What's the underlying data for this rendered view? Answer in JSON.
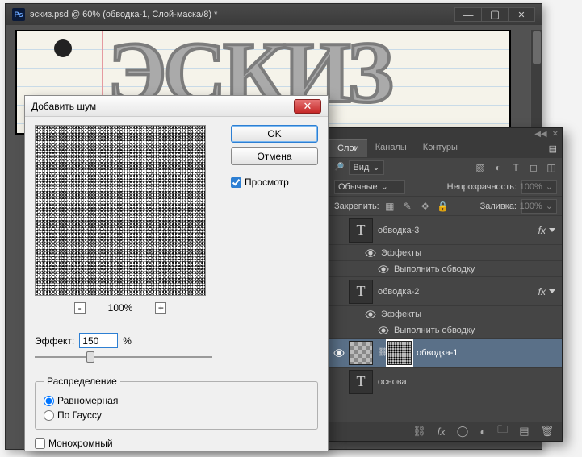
{
  "main": {
    "title": "эскиз.psd @ 60% (обводка-1, Слой-маска/8) *",
    "ps_label": "Ps",
    "sketch_text": "ЭСКИЗ"
  },
  "dialog": {
    "title": "Добавить шум",
    "ok": "OK",
    "cancel": "Отмена",
    "preview_label": "Просмотр",
    "preview_checked": true,
    "zoom": "100%",
    "amount_label": "Эффект:",
    "amount_value": "150",
    "amount_suffix": "%",
    "distribution_legend": "Распределение",
    "uniform": "Равномерная",
    "gaussian": "По Гауссу",
    "monochrome": "Монохромный",
    "monochrome_checked": false
  },
  "panels": {
    "tabs": [
      "Слои",
      "Каналы",
      "Контуры"
    ],
    "active_tab": 0,
    "kind_label": "Вид",
    "blend_mode": "Обычные",
    "opacity_label": "Непрозрачность:",
    "opacity_value": "100%",
    "lock_label": "Закрепить:",
    "fill_label": "Заливка:",
    "fill_value": "100%",
    "effects_label": "Эффекты",
    "stroke_effect_label": "Выполнить обводку",
    "layers": [
      {
        "name": "обводка-3",
        "type": "text",
        "fx": true,
        "expanded": true,
        "visible": false
      },
      {
        "name": "обводка-2",
        "type": "text",
        "fx": true,
        "expanded": true,
        "visible": false
      },
      {
        "name": "обводка-1",
        "type": "mask",
        "selected": true,
        "visible": true
      },
      {
        "name": "основа",
        "type": "text",
        "visible": false
      }
    ]
  }
}
